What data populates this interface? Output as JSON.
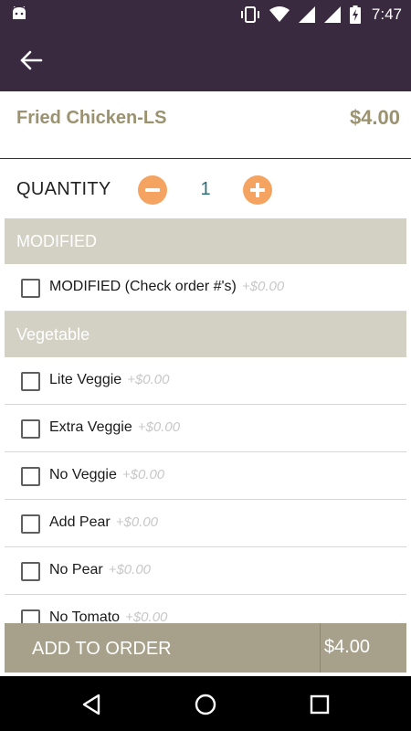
{
  "status_bar": {
    "time": "7:47",
    "icons": [
      "android-icon",
      "vibrate-icon",
      "wifi-icon",
      "signal-icon",
      "signal-icon",
      "battery-charging-icon"
    ]
  },
  "app_bar": {
    "back_icon": "arrow-back-icon"
  },
  "item": {
    "name": "Fried Chicken-LS",
    "price": "$4.00"
  },
  "quantity": {
    "label": "QUANTITY",
    "value": "1",
    "minus_icon": "minus-icon",
    "plus_icon": "plus-icon"
  },
  "sections": [
    {
      "title": "MODIFIED",
      "options": [
        {
          "label": "MODIFIED (Check order #'s)",
          "price": "+$0.00",
          "checked": false
        }
      ]
    },
    {
      "title": "Vegetable",
      "options": [
        {
          "label": "Lite Veggie",
          "price": "+$0.00",
          "checked": false
        },
        {
          "label": "Extra Veggie",
          "price": "+$0.00",
          "checked": false
        },
        {
          "label": "No Veggie",
          "price": "+$0.00",
          "checked": false
        },
        {
          "label": "Add Pear",
          "price": "+$0.00",
          "checked": false
        },
        {
          "label": "No Pear",
          "price": "+$0.00",
          "checked": false
        },
        {
          "label": "No Tomato",
          "price": "+$0.00",
          "checked": false
        }
      ]
    }
  ],
  "footer": {
    "add_label": "ADD TO ORDER",
    "total": "$4.00"
  },
  "nav": {
    "back_icon": "nav-back-icon",
    "home_icon": "nav-home-icon",
    "recents_icon": "nav-recents-icon"
  },
  "colors": {
    "app_bar": "#3a2a3f",
    "accent_gold": "#9b9270",
    "section_bg": "#d3d1c3",
    "qty_button": "#f4a361",
    "qty_value": "#2b6f7a",
    "footer_bg": "#a7a08a"
  }
}
